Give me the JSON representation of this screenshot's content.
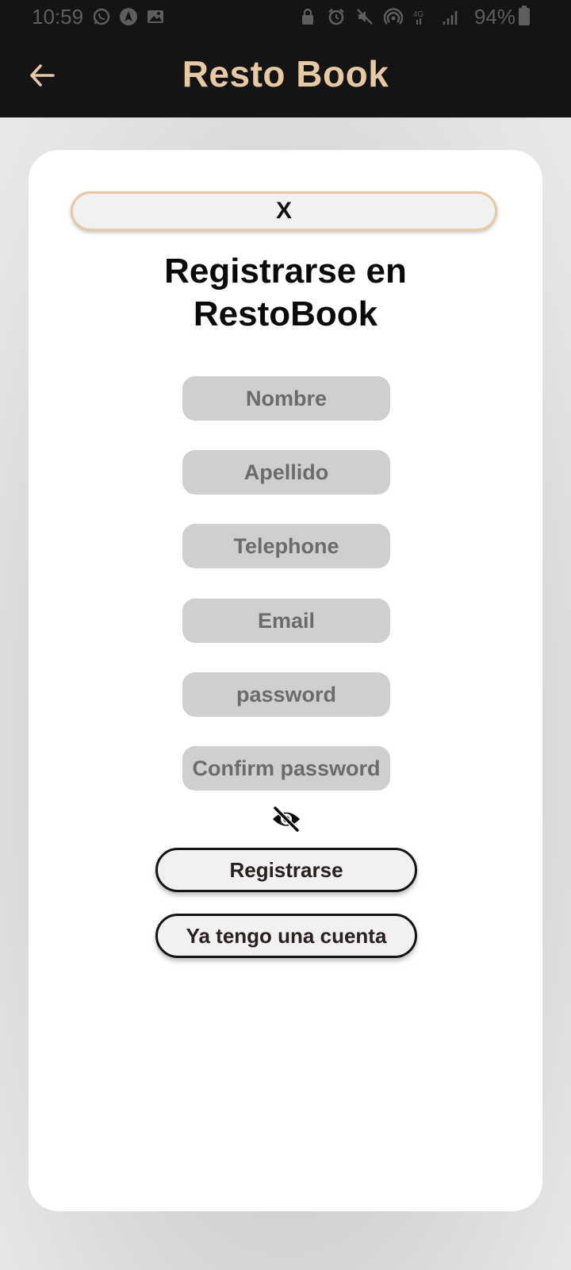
{
  "status_bar": {
    "time": "10:59",
    "battery_percent": "94%",
    "left_icons": [
      "whatsapp-icon",
      "navigation-app-icon",
      "gallery-icon"
    ],
    "right_icons": [
      "lock-icon",
      "alarm-icon",
      "mute-icon",
      "hotspot-icon",
      "4g-icon",
      "signal-icon"
    ]
  },
  "app_bar": {
    "back_icon": "arrow-left-icon",
    "title": "Resto Book",
    "title_color": "#e8c9a6"
  },
  "modal": {
    "close_label": "X",
    "title_line1": "Registrarse en",
    "title_line2": "RestoBook",
    "fields": {
      "first_name_placeholder": "Nombre",
      "last_name_placeholder": "Apellido",
      "phone_placeholder": "Telephone",
      "email_placeholder": "Email",
      "password_placeholder": "password",
      "confirm_password_placeholder": "Confirm password"
    },
    "password_visibility_icon": "eye-slash-icon",
    "register_label": "Registrarse",
    "have_account_label": "Ya tengo una cuenta"
  }
}
